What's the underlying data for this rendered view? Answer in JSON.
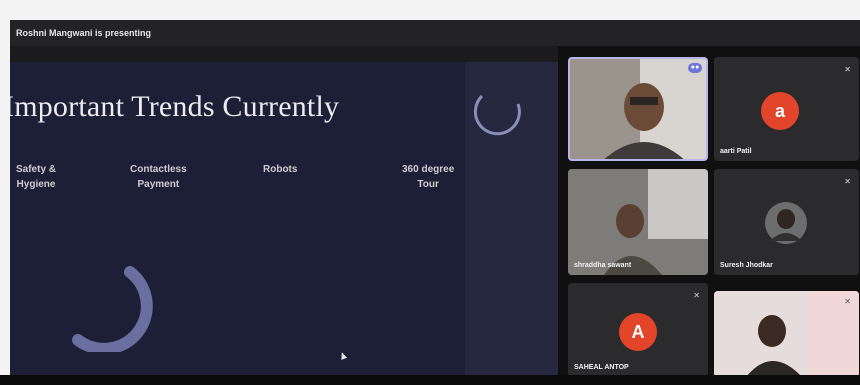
{
  "presenter_banner": "Roshni Mangwani is presenting",
  "slide": {
    "title": "Important Trends Currently",
    "trends": [
      {
        "label": "Safety &\nHygiene"
      },
      {
        "label": "Contactless\nPayment"
      },
      {
        "label": "Robots"
      },
      {
        "label": "360 degree\nTour"
      }
    ]
  },
  "participants": [
    {
      "name": "",
      "type": "video",
      "pinned": true
    },
    {
      "name": "aarti Patil",
      "type": "avatar",
      "initial": "a",
      "color": "#e2452a"
    },
    {
      "name": "shraddha sawant",
      "type": "video"
    },
    {
      "name": "Suresh Jhodkar",
      "type": "photo"
    },
    {
      "name": "SAHEAL ANTOP",
      "type": "avatar",
      "initial": "A",
      "color": "#e2452a"
    },
    {
      "name": "",
      "type": "video"
    }
  ],
  "icons": {
    "mic": "mic-muted-icon",
    "pin": "pin-icon"
  }
}
